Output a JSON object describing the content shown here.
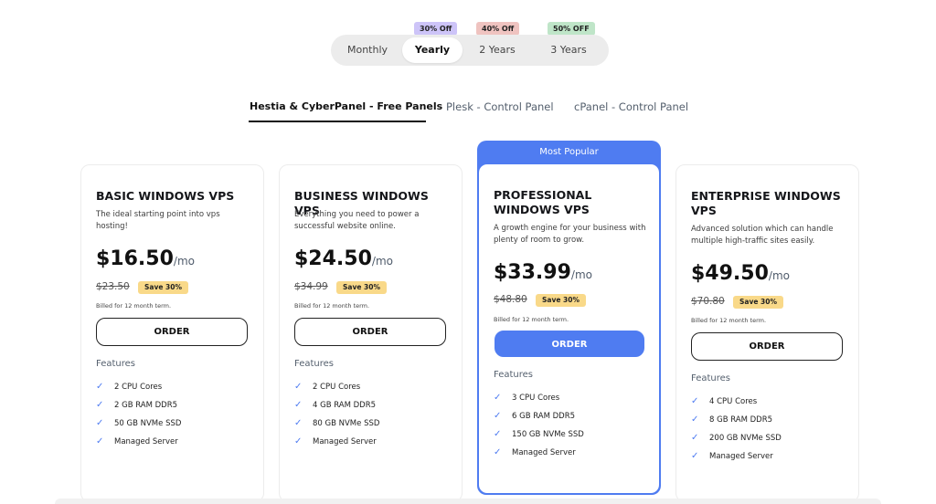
{
  "billing": {
    "options": [
      "Monthly",
      "Yearly",
      "2 Years",
      "3 Years"
    ],
    "selected": "Yearly",
    "badges": [
      "30% Off",
      "40% Off",
      "50% OFF"
    ]
  },
  "tabs": [
    "Hestia & CyberPanel - Free Panels",
    "Plesk - Control Panel",
    "cPanel - Control Panel"
  ],
  "active_tab": "Hestia & CyberPanel - Free Panels",
  "popular_label": "Most Popular",
  "plans": [
    {
      "name": "BASIC WINDOWS VPS",
      "description": "The ideal starting point into vps hosting!",
      "price": "$16.50",
      "per": "/mo",
      "old_price": "$23.50",
      "save": "Save 30%",
      "billed": "Billed for 12 month term.",
      "order": "ORDER",
      "features_title": "Features",
      "features": [
        "2 CPU Cores",
        "2 GB RAM DDR5",
        "50 GB NVMe SSD",
        "Managed Server"
      ]
    },
    {
      "name": "BUSINESS WINDOWS VPS",
      "description": "Everything you need to power a successful website online.",
      "price": "$24.50",
      "per": "/mo",
      "old_price": "$34.99",
      "save": "Save 30%",
      "billed": "Billed for 12 month term.",
      "order": "ORDER",
      "features_title": "Features",
      "features": [
        "2 CPU Cores",
        "4 GB RAM DDR5",
        "80 GB NVMe SSD",
        "Managed Server"
      ]
    },
    {
      "name": "PROFESSIONAL WINDOWS VPS",
      "description": "A growth engine for your business with plenty of room to grow.",
      "price": "$33.99",
      "per": "/mo",
      "old_price": "$48.80",
      "save": "Save 30%",
      "billed": "Billed for 12 month term.",
      "order": "ORDER",
      "features_title": "Features",
      "features": [
        "3 CPU Cores",
        "6 GB RAM DDR5",
        "150 GB NVMe SSD",
        "Managed Server"
      ]
    },
    {
      "name": "ENTERPRISE WINDOWS VPS",
      "description": "Advanced solution which can handle multiple high-traffic sites easily.",
      "price": "$49.50",
      "per": "/mo",
      "old_price": "$70.80",
      "save": "Save 30%",
      "billed": "Billed for 12 month term.",
      "order": "ORDER",
      "features_title": "Features",
      "features": [
        "4 CPU Cores",
        "8 GB RAM DDR5",
        "200 GB NVMe SSD",
        "Managed Server"
      ]
    }
  ],
  "colors": {
    "accent": "#4f7cf1",
    "save_badge": "#f9d989",
    "badge_30": "#cdc4f8",
    "badge_40": "#efc3c0",
    "badge_50": "#bfe5c8",
    "toggle_bg": "#ececec"
  },
  "icons": {
    "feature": "check-icon"
  }
}
